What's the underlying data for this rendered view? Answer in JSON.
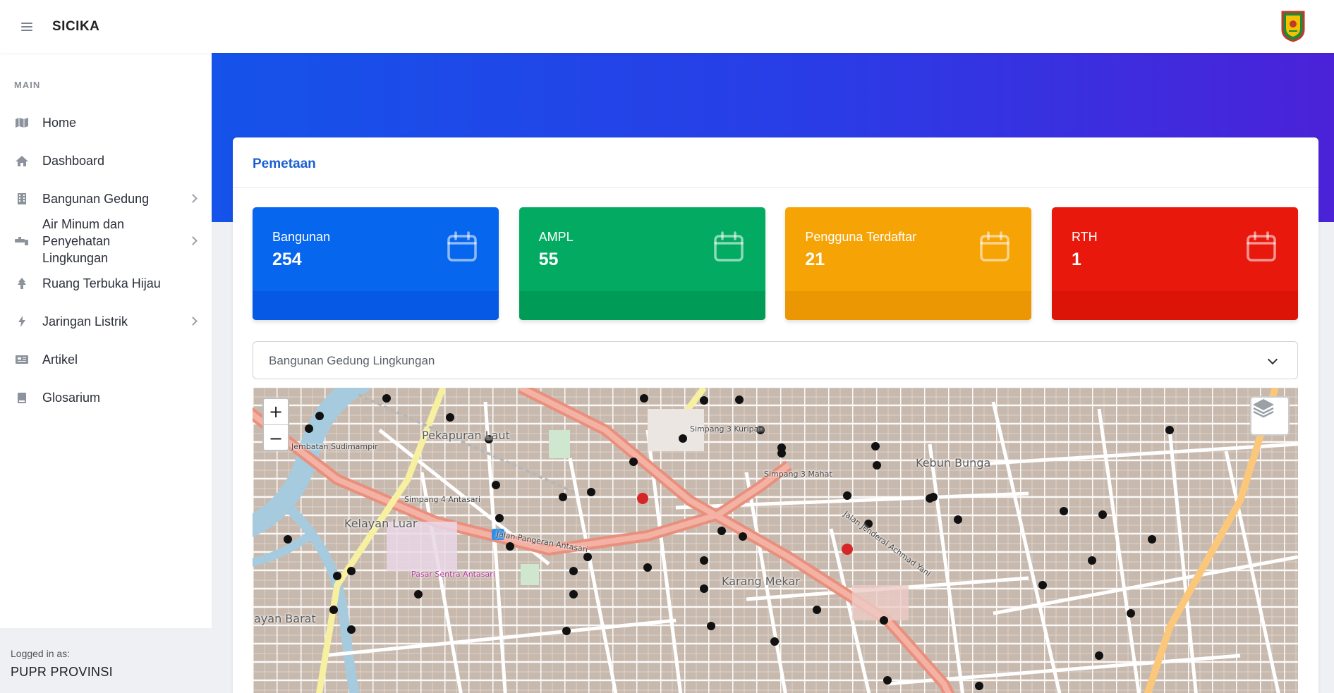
{
  "app": {
    "brand": "SICIKA"
  },
  "sidebar": {
    "section_title": "MAIN",
    "items": [
      {
        "label": "Home",
        "icon": "map-icon",
        "has_submenu": false
      },
      {
        "label": "Dashboard",
        "icon": "home-icon",
        "has_submenu": false
      },
      {
        "label": "Bangunan Gedung",
        "icon": "building-icon",
        "has_submenu": true
      },
      {
        "label": "Air Minum dan Penyehatan Lingkungan",
        "icon": "faucet-icon",
        "has_submenu": true
      },
      {
        "label": "Ruang Terbuka Hijau",
        "icon": "tree-icon",
        "has_submenu": false
      },
      {
        "label": "Jaringan Listrik",
        "icon": "bolt-icon",
        "has_submenu": true
      },
      {
        "label": "Artikel",
        "icon": "newspaper-icon",
        "has_submenu": false
      },
      {
        "label": "Glosarium",
        "icon": "book-icon",
        "has_submenu": false
      }
    ],
    "footer": {
      "caption": "Logged in as:",
      "user": "PUPR PROVINSI"
    }
  },
  "card": {
    "title": "Pemetaan",
    "stats": [
      {
        "label": "Bangunan",
        "value": "254",
        "color": "#0766ee",
        "icon": "calendar-icon"
      },
      {
        "label": "AMPL",
        "value": "55",
        "color": "#03ab62",
        "icon": "calendar-icon"
      },
      {
        "label": "Pengguna Terdaftar",
        "value": "21",
        "color": "#f6a306",
        "icon": "calendar-icon"
      },
      {
        "label": "RTH",
        "value": "1",
        "color": "#e9180c",
        "icon": "calendar-icon"
      }
    ],
    "layer_select": {
      "selected": "Bangunan Gedung Lingkungan"
    },
    "map": {
      "zoom_in": "+",
      "zoom_out": "−",
      "labels": {
        "pekapuran": "Pekapuran Laut",
        "jembatan": "Jembatan Sudimampir",
        "kelayan_luar": "Kelayan Luar",
        "kebun_bunga": "Kebun Bunga",
        "karang_mekar": "Karang Mekar",
        "pasar": "Pasar Sentra Antasari",
        "simpang4": "Simpang 4 Antasari",
        "simpang3k": "Simpang 3 Kuripan",
        "simpang3m": "Simpang 3 Mahat",
        "antasari": "Jalan Pangeran Antasari",
        "achmad_yani": "Jalan Jenderal Achmad Yani",
        "barat": "ayan Barat"
      }
    }
  }
}
